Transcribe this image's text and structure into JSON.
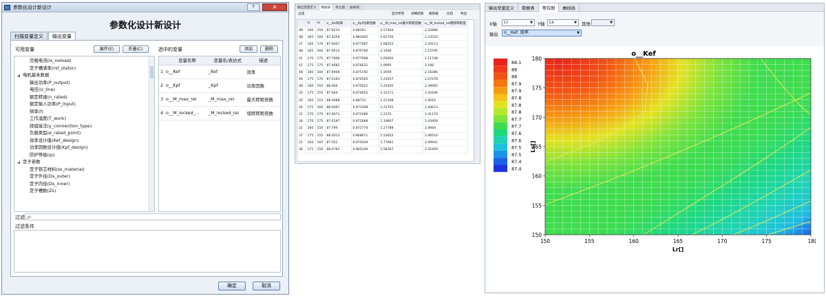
{
  "dialog": {
    "title": "参数化设计新设计",
    "heading": "参数化设计新设计",
    "close_label": "✕",
    "help_label": "?",
    "tabs": [
      "扫描变量定义",
      "输出变量"
    ],
    "available_label": "可用变量",
    "expand_btn": "展开(E)",
    "collapse_btn": "折叠(C)",
    "selected_label": "选中的变量",
    "add_btn": "添加",
    "delete_btn": "删除",
    "tree": [
      {
        "text": "空载电流(Is_noload)",
        "indent": 2
      },
      {
        "text": "定子槽满率(rsf_stator)",
        "indent": 2
      },
      {
        "text": "电机基本数据",
        "indent": 1,
        "caret": "◢"
      },
      {
        "text": "输出功率(P_output)",
        "indent": 2
      },
      {
        "text": "电压(U_line)",
        "indent": 2
      },
      {
        "text": "额定转速(n_rated)",
        "indent": 2
      },
      {
        "text": "额定输入功率(P_input)",
        "indent": 2
      },
      {
        "text": "频率(f)",
        "indent": 2
      },
      {
        "text": "工作温度(T_work)",
        "indent": 2
      },
      {
        "text": "绕组接法(y_connection_type)",
        "indent": 2
      },
      {
        "text": "负载类型(e_rated_point)",
        "indent": 2
      },
      {
        "text": "效率设计值(Kef_design)",
        "indent": 2
      },
      {
        "text": "功率因数设计值(Kpf_design)",
        "indent": 2
      },
      {
        "text": "防护等级(ip)",
        "indent": 2
      },
      {
        "text": "定子参数",
        "indent": 1,
        "caret": "◢"
      },
      {
        "text": "定子铁芯材料(ss_material)",
        "indent": 2
      },
      {
        "text": "定子外径(Ds_outer)",
        "indent": 2
      },
      {
        "text": "定子内径(Ds_inner)",
        "indent": 2
      },
      {
        "text": "定子槽数(Zs)",
        "indent": 2
      }
    ],
    "table_headers": [
      "变量名称",
      "变量名/表达式",
      "描述"
    ],
    "rows": [
      {
        "idx": "1",
        "name": "o__Kef",
        "expr": "_Kef",
        "desc": "效率"
      },
      {
        "idx": "2",
        "name": "o__Kpf",
        "expr": "_Kpf",
        "desc": "功率因数"
      },
      {
        "idx": "3",
        "name": "o__M_max_rel",
        "expr": "_M_max_rel",
        "desc": "最大转矩倍数"
      },
      {
        "idx": "4",
        "name": "o__M_locked_...",
        "expr": "_M_locked_rel",
        "desc": "堵转转矩倍数"
      }
    ],
    "filter_label": "过滤:",
    "filter_placeholder": "ρ-",
    "condition_label": "过滤条件",
    "ok_btn": "确定",
    "cancel_btn": "取消"
  },
  "results": {
    "tabs": [
      "输出变量定义",
      "数据表",
      "等位图",
      "曲线线"
    ],
    "toolbar": [
      "过滤",
      "显示所有",
      "详细结果",
      "重新载",
      "比较",
      "导出"
    ],
    "headers": [
      "Lr",
      "Ls",
      "o__Kef效率",
      "o__Kpf功率因数",
      "o__M_max_rel最大转矩倍数",
      "o__M_locked_rel堵转转矩倍"
    ],
    "rows": [
      [
        "4B",
        "160",
        "150",
        "87.8233",
        "0.88261",
        "2.57464",
        "2.22886"
      ],
      [
        "4B",
        "165",
        "160",
        "87.8356",
        "0.883402",
        "2.62756",
        "2.23524"
      ],
      [
        "47",
        "160",
        "170",
        "87.9047",
        "0.877067",
        "2.68252",
        "2.29113"
      ],
      [
        "4B",
        "165",
        "160",
        "87.9512",
        "0.875760",
        "2.1046",
        "2.15795"
      ],
      [
        "41",
        "170",
        "175",
        "87.7806",
        "0.877908",
        "1.65692",
        "2.11748"
      ],
      [
        "41",
        "175",
        "175",
        "87.4682",
        "0.876631",
        "1.9995",
        "2.108"
      ],
      [
        "4B",
        "160",
        "160",
        "87.9946",
        "0.875192",
        "1.3059",
        "2.16286"
      ],
      [
        "40",
        "175",
        "170",
        "87.6163",
        "0.874565",
        "1.23457",
        "2.27478"
      ],
      [
        "4B",
        "160",
        "155",
        "88.004",
        "0.875621",
        "1.25405",
        "2.39965"
      ],
      [
        "20",
        "175",
        "155",
        "87.664",
        "0.874652",
        "2.12371",
        "2.42446"
      ],
      [
        "20",
        "160",
        "155",
        "88.0688",
        "0.88712",
        "1.21308",
        "2.4616"
      ],
      [
        "26",
        "175",
        "160",
        "88.0067",
        "0.871408",
        "1.22791",
        "2.44613"
      ],
      [
        "22",
        "170",
        "170",
        "87.8071",
        "0.872086",
        "1.2225",
        "2.41174"
      ],
      [
        "34",
        "170",
        "175",
        "87.6197",
        "0.872688",
        "1.19807",
        "2.43409"
      ],
      [
        "21",
        "160",
        "150",
        "87.794",
        "0.872774",
        "1.27788",
        "2.4944"
      ],
      [
        "37",
        "175",
        "155",
        "88.0013",
        "0.868611",
        "1.53652",
        "2.46516"
      ],
      [
        "22",
        "160",
        "165",
        "87.051",
        "0.870549",
        "1.77681",
        "2.49941"
      ],
      [
        "36",
        "175",
        "150",
        "88.0762",
        "0.865249",
        "1.58397",
        "2.51609"
      ]
    ]
  },
  "contour": {
    "tabs": [
      "输出变量定义",
      "数据表",
      "等位图",
      "曲线线"
    ],
    "x_axis_label": "X轴",
    "x_axis_value": "Lr",
    "y_axis_label": "Y轴",
    "y_axis_value": "Ls",
    "other_label": "其他",
    "other_value": "",
    "output_label": "输出",
    "output_value": "o__Kef: 效率"
  },
  "chart_data": {
    "type": "heatmap",
    "title": "o__Kef",
    "xlabel": "Lr[]",
    "ylabel": "Ls[]",
    "xlim": [
      150,
      180
    ],
    "ylim": [
      150,
      180
    ],
    "x_ticks": [
      "150",
      "155",
      "160",
      "165",
      "170",
      "175",
      "18("
    ],
    "y_ticks": [
      "150",
      "155",
      "160",
      "165",
      "170",
      "175",
      "180"
    ],
    "colorbar": [
      {
        "label": "88.1",
        "color": "#e8231e"
      },
      {
        "label": "88",
        "color": "#ee3a18"
      },
      {
        "label": "88",
        "color": "#f25414"
      },
      {
        "label": "87.9",
        "color": "#f57512"
      },
      {
        "label": "87.9",
        "color": "#f79a13"
      },
      {
        "label": "87.8",
        "color": "#f5c21b"
      },
      {
        "label": "87.8",
        "color": "#e3e221"
      },
      {
        "label": "87.8",
        "color": "#b6e82a"
      },
      {
        "label": "87.7",
        "color": "#7fe33a"
      },
      {
        "label": "87.7",
        "color": "#3edc4e"
      },
      {
        "label": "87.6",
        "color": "#1fd87e"
      },
      {
        "label": "87.6",
        "color": "#1ed3b4"
      },
      {
        "label": "87.5",
        "color": "#1ec0e0"
      },
      {
        "label": "87.5",
        "color": "#1b92e8"
      },
      {
        "label": "87.4",
        "color": "#1a63e6"
      },
      {
        "label": "87.4",
        "color": "#1c34de"
      }
    ],
    "legend_position": "left",
    "grid": true
  }
}
